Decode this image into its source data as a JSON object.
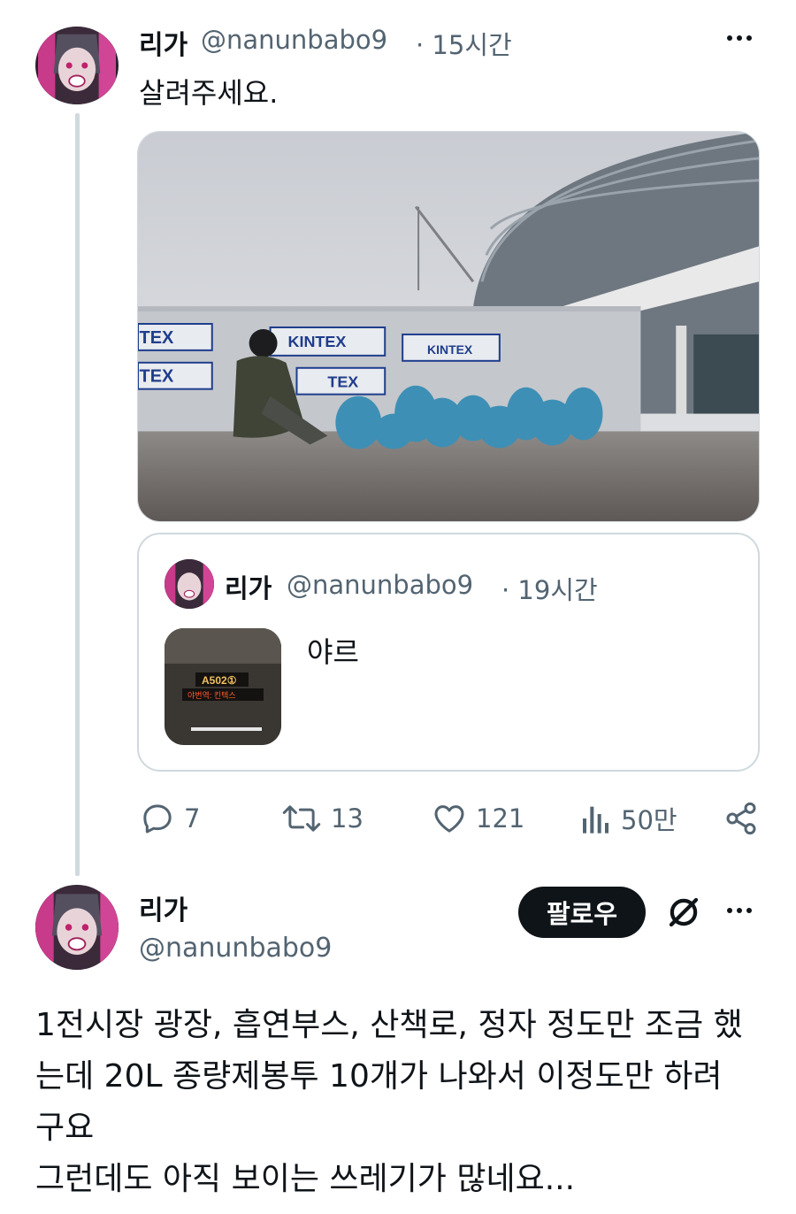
{
  "tweet": {
    "author_name": "리가",
    "author_handle": "@nanunbabo9",
    "time": "· 15시간",
    "text": "살려주세요.",
    "quote": {
      "author_name": "리가",
      "author_handle": "@nanunbabo9",
      "time": "· 19시간",
      "text": "야르"
    },
    "photo_signs": [
      "KINTEX",
      "KINTEX",
      "KINTEX",
      "ITEX",
      "ITEX",
      "TEX"
    ],
    "quote_thumb_signs": [
      "A502①",
      "야번역: 킨텍스"
    ],
    "actions": {
      "replies": "7",
      "retweets": "13",
      "likes": "121",
      "views": "50만"
    }
  },
  "reply": {
    "author_name": "리가",
    "author_handle": "@nanunbabo9",
    "follow_label": "팔로우",
    "text_lines": [
      "1전시장 광장, 흡연부스, 산책로, 정자 정도만 조금 했",
      "는데 20L 종량제봉투 10개가 나와서 이정도만 하려",
      "구요",
      "그런데도 아직 보이는 쓰레기가 많네요..."
    ]
  },
  "colors": {
    "text": "#0f1419",
    "muted": "#536471",
    "border": "#cfd9de",
    "button_bg": "#0f1419",
    "button_text": "#ffffff"
  }
}
